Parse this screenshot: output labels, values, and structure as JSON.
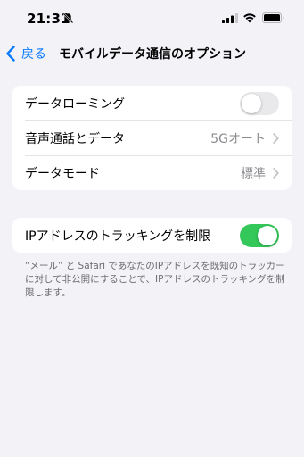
{
  "status_bar": {
    "time": "21:31",
    "icons": [
      "bell-slash-icon",
      "signal-icon",
      "wifi-icon",
      "battery-icon"
    ]
  },
  "nav": {
    "back_label": "戻る",
    "title": "モバイルデータ通信のオプション"
  },
  "group1": {
    "rows": [
      {
        "label": "データローミング",
        "toggle": false
      },
      {
        "label": "音声通話とデータ",
        "value": "5Gオート"
      },
      {
        "label": "データモード",
        "value": "標準"
      }
    ]
  },
  "group2": {
    "rows": [
      {
        "label": "IPアドレスのトラッキングを制限",
        "toggle": true
      }
    ]
  },
  "footer_note": "“メール” と Safari であなたのIPアドレスを既知のトラッカーに対して非公開にすることで、IPアドレスのトラッキングを制限します。",
  "colors": {
    "accent": "#0a7aff",
    "toggle_on": "#34c759",
    "toggle_off": "#e9e9eb",
    "background": "#f2f2f7"
  }
}
